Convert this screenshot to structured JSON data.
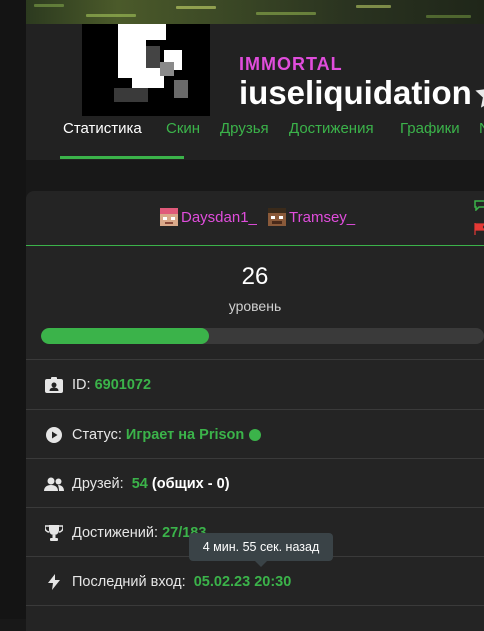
{
  "profile": {
    "rank": "IMMORTAL",
    "nickname": "iuseliquidation"
  },
  "tabs": [
    {
      "label": "Статистика",
      "active": true
    },
    {
      "label": "Скин"
    },
    {
      "label": "Друзья"
    },
    {
      "label": "Достижения"
    },
    {
      "label": "Графики"
    },
    {
      "label": "N"
    }
  ],
  "players": [
    {
      "name": "Daysdan1_"
    },
    {
      "name": "Tramsey_"
    }
  ],
  "level": {
    "value": "26",
    "label": "уровень",
    "progress": 0.38
  },
  "stats": {
    "id_label": "ID:",
    "id_value": "6901072",
    "status_label": "Статус:",
    "status_value": "Играет на Prison",
    "friends_label": "Друзей:",
    "friends_value": "54",
    "friends_common": "(общих - 0)",
    "achievements_label": "Достижений:",
    "achievements_value": "27/183",
    "last_login_label": "Последний вход:",
    "last_login_value": "05.02.23 20:30"
  },
  "tooltip": {
    "text": "4 мин. 55 сек. назад"
  },
  "colors": {
    "accent_green": "#3bb34a",
    "rank_magenta": "#e04ddc",
    "background": "#181818",
    "panel": "#242424"
  },
  "icons": [
    "star-icon",
    "id-card-icon",
    "play-circle-icon",
    "users-icon",
    "trophy-icon",
    "bolt-icon",
    "chat-icon",
    "flag-icon"
  ]
}
